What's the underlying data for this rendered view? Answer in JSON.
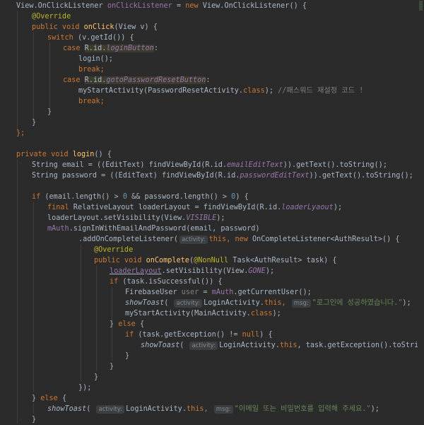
{
  "editor": {
    "language": "Java",
    "hint_activity": "activity:",
    "hint_msg": "msg:",
    "line1": {
      "a": "View.OnClickListener ",
      "b": "onClickListener",
      "c": " = ",
      "d": "new",
      "e": " View.OnClickListener() {"
    },
    "line2": {
      "a": "@Override"
    },
    "line3": {
      "a": "public void ",
      "b": "onClick",
      "c": "(View v) {"
    },
    "line4": {
      "a": "switch",
      "b": " (v.getId()) {"
    },
    "line5": {
      "a": "case ",
      "b": "R.id.",
      "c": "loginButton",
      "d": ":"
    },
    "line6": {
      "a": "login();"
    },
    "line7": {
      "a": "break;"
    },
    "line8": {
      "a": "case ",
      "b": "R.id.",
      "c": "gotoPasswordResetButton",
      "d": ":"
    },
    "line9": {
      "a": "myStartActivity(PasswordResetActivity.",
      "b": "class",
      "c": "); ",
      "d": "//패스워드 재설정 코드 !"
    },
    "line10": {
      "a": "break;"
    },
    "line11": {
      "a": "}"
    },
    "line12": {
      "a": "}"
    },
    "line13": {
      "a": "};"
    },
    "line15": {
      "a": "private void ",
      "b": "login",
      "c": "() {"
    },
    "line16": {
      "a": "String email = ((EditText) findViewById(R.id.",
      "b": "emailEditText",
      "c": ")).getText().toString();"
    },
    "line17": {
      "a": "String password = ((EditText) findViewById(R.id.",
      "b": "passwordEditText",
      "c": ")).getText().toString();"
    },
    "line19": {
      "a": "if",
      "b": " (email.length() > ",
      "c": "0",
      "d": " && password.length() > ",
      "e": "0",
      "f": ") {"
    },
    "line20": {
      "a": "final",
      "b": " RelativeLayout loaderLayout = findViewById(R.id.",
      "c": "loaderLyaout",
      "d": ");"
    },
    "line21": {
      "a": "loaderLayout.setVisibility(View.",
      "b": "VISIBLE",
      "c": ");"
    },
    "line22": {
      "a": "mAuth",
      "b": ".signInWithEmailAndPassword(email, password)"
    },
    "line23": {
      "a": ".addOnCompleteListener(",
      "b": "this",
      "c": ", ",
      "d": "new",
      "e": " OnCompleteListener<AuthResult>() {"
    },
    "line24": {
      "a": "@Override"
    },
    "line25": {
      "a": "public void ",
      "b": "onComplete",
      "c": "(",
      "d": "@NonNull",
      "e": " Task<AuthResult> task) {"
    },
    "line26": {
      "a": "loaderLayout",
      "b": ".setVisibility(View.",
      "c": "GONE",
      "d": ");"
    },
    "line27": {
      "a": "if",
      "b": " (task.isSuccessful()) {"
    },
    "line28": {
      "a": "FirebaseUser ",
      "b": "user",
      "c": " = ",
      "d": "mAuth",
      "e": ".getCurrentUser();"
    },
    "line29": {
      "a": "showToast",
      "b": "( ",
      "c": "LoginActivity.",
      "d": "this",
      "e": ", ",
      "f": "\"로그인에 성공하였습니다.\"",
      "g": ");"
    },
    "line30": {
      "a": "myStartActivity(MainActivity.",
      "b": "class",
      "c": ");"
    },
    "line31": {
      "a": "} ",
      "b": "else",
      "c": " {"
    },
    "line32": {
      "a": "if",
      "b": " (task.getException() != ",
      "c": "null",
      "d": ") {"
    },
    "line33": {
      "a": "showToast",
      "b": "( ",
      "c": "LoginActivity.",
      "d": "this",
      "e": ", task.getException().toString());"
    },
    "line34": {
      "a": "}"
    },
    "line35": {
      "a": "}"
    },
    "line36": {
      "a": "}"
    },
    "line37": {
      "a": "});"
    },
    "line38": {
      "a": "} ",
      "b": "else",
      "c": " {"
    },
    "line39": {
      "a": "showToast",
      "b": "( ",
      "c": "LoginActivity.",
      "d": "this",
      "e": ", ",
      "f": "\"이메일 또는 비밀번호를 입력해 주세요.\"",
      "g": ");"
    },
    "line40": {
      "a": "}"
    }
  },
  "colors": {
    "background": "#2b2b2b",
    "keyword": "#cc7832",
    "annotation": "#bbb529",
    "method": "#ffc66d",
    "string": "#6a8759",
    "number": "#6897bb",
    "comment": "#808080",
    "field": "#9876aa"
  }
}
